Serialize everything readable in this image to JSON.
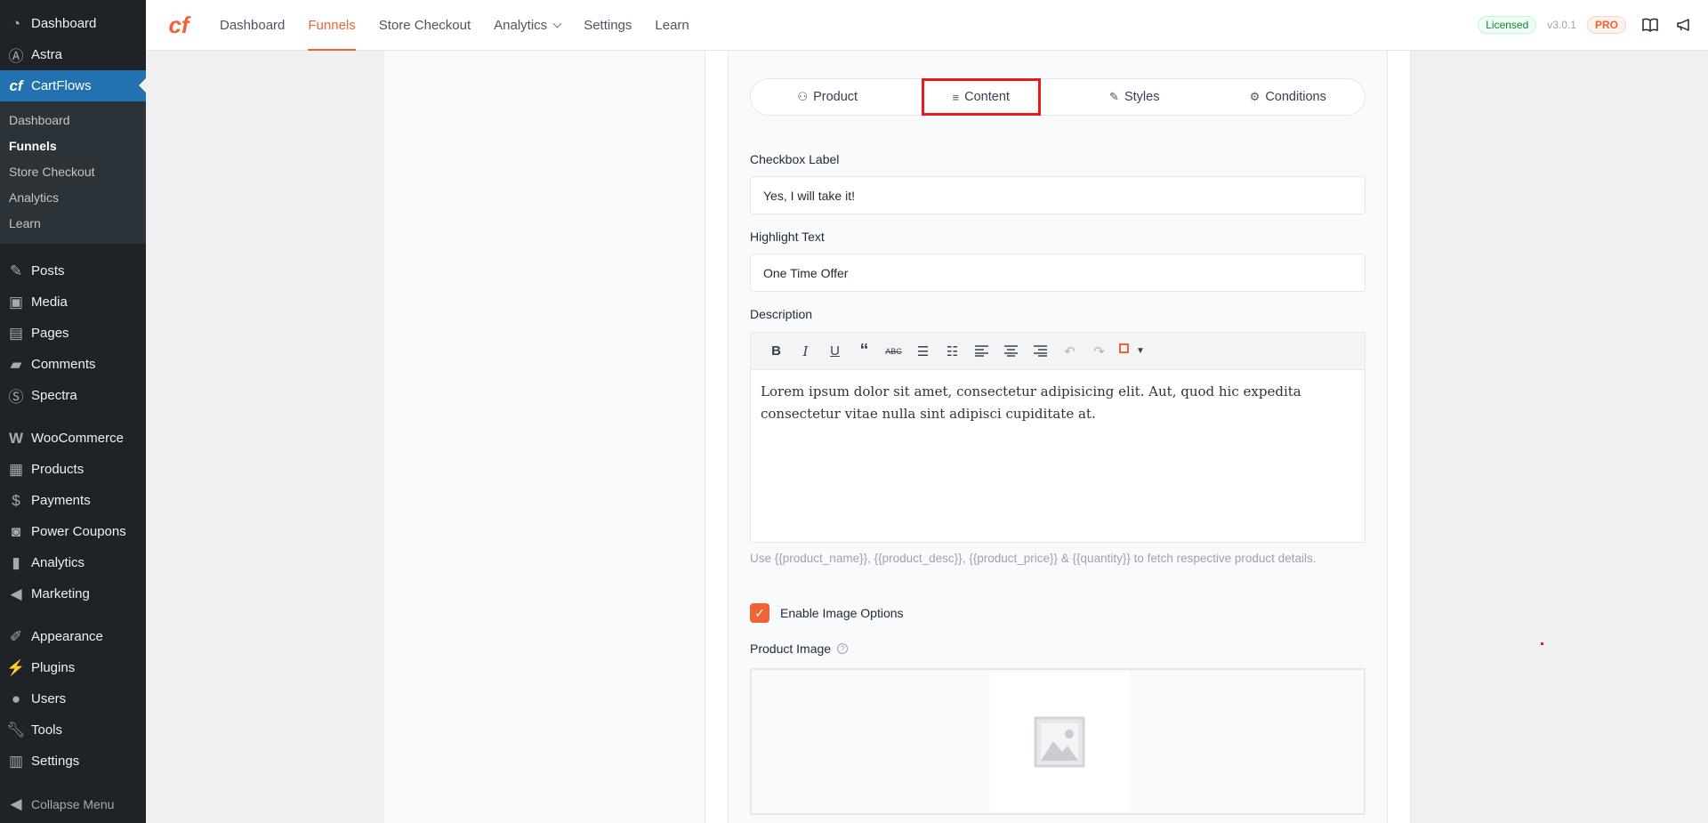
{
  "sidebar": {
    "top_items": [
      {
        "label": "Dashboard",
        "icon": "dashboard-icon"
      },
      {
        "label": "Astra",
        "icon": "astra-icon"
      },
      {
        "label": "CartFlows",
        "icon": "cartflows-icon"
      }
    ],
    "cartflows_sub": [
      "Dashboard",
      "Funnels",
      "Store Checkout",
      "Analytics",
      "Learn"
    ],
    "group2": [
      {
        "label": "Posts",
        "icon": "pin-icon"
      },
      {
        "label": "Media",
        "icon": "media-icon"
      },
      {
        "label": "Pages",
        "icon": "pages-icon"
      },
      {
        "label": "Comments",
        "icon": "comment-icon"
      },
      {
        "label": "Spectra",
        "icon": "spectra-icon"
      }
    ],
    "group3": [
      {
        "label": "WooCommerce",
        "icon": "woo-icon"
      },
      {
        "label": "Products",
        "icon": "products-icon"
      },
      {
        "label": "Payments",
        "icon": "payments-icon"
      },
      {
        "label": "Power Coupons",
        "icon": "coupons-icon"
      },
      {
        "label": "Analytics",
        "icon": "bar-chart-icon"
      },
      {
        "label": "Marketing",
        "icon": "megaphone-icon"
      }
    ],
    "group4": [
      {
        "label": "Appearance",
        "icon": "brush-icon"
      },
      {
        "label": "Plugins",
        "icon": "plug-icon"
      },
      {
        "label": "Users",
        "icon": "user-icon"
      },
      {
        "label": "Tools",
        "icon": "wrench-icon"
      },
      {
        "label": "Settings",
        "icon": "settings-icon"
      }
    ],
    "collapse_label": "Collapse Menu"
  },
  "topnav": {
    "items": [
      "Dashboard",
      "Funnels",
      "Store Checkout",
      "Analytics",
      "Settings",
      "Learn"
    ],
    "licensed": "Licensed",
    "version": "v3.0.1",
    "pro": "PRO"
  },
  "tabs": [
    "Product",
    "Content",
    "Styles",
    "Conditions"
  ],
  "form": {
    "checkbox_label_title": "Checkbox Label",
    "checkbox_label_value": "Yes, I will take it!",
    "highlight_title": "Highlight Text",
    "highlight_value": "One Time Offer",
    "description_title": "Description",
    "description_text": "Lorem ipsum dolor sit amet, consectetur adipisicing elit. Aut, quod hic expedita consectetur vitae nulla sint adipisci cupiditate at.",
    "help_text": "Use {{product_name}}, {{product_desc}}, {{product_price}} & {{quantity}} to fetch respective product details.",
    "enable_image_label": "Enable Image Options",
    "product_image_label": "Product Image"
  },
  "colors": {
    "brand": "#f06335",
    "wp_active": "#2271b1",
    "highlight_border": "#e11d1d"
  }
}
